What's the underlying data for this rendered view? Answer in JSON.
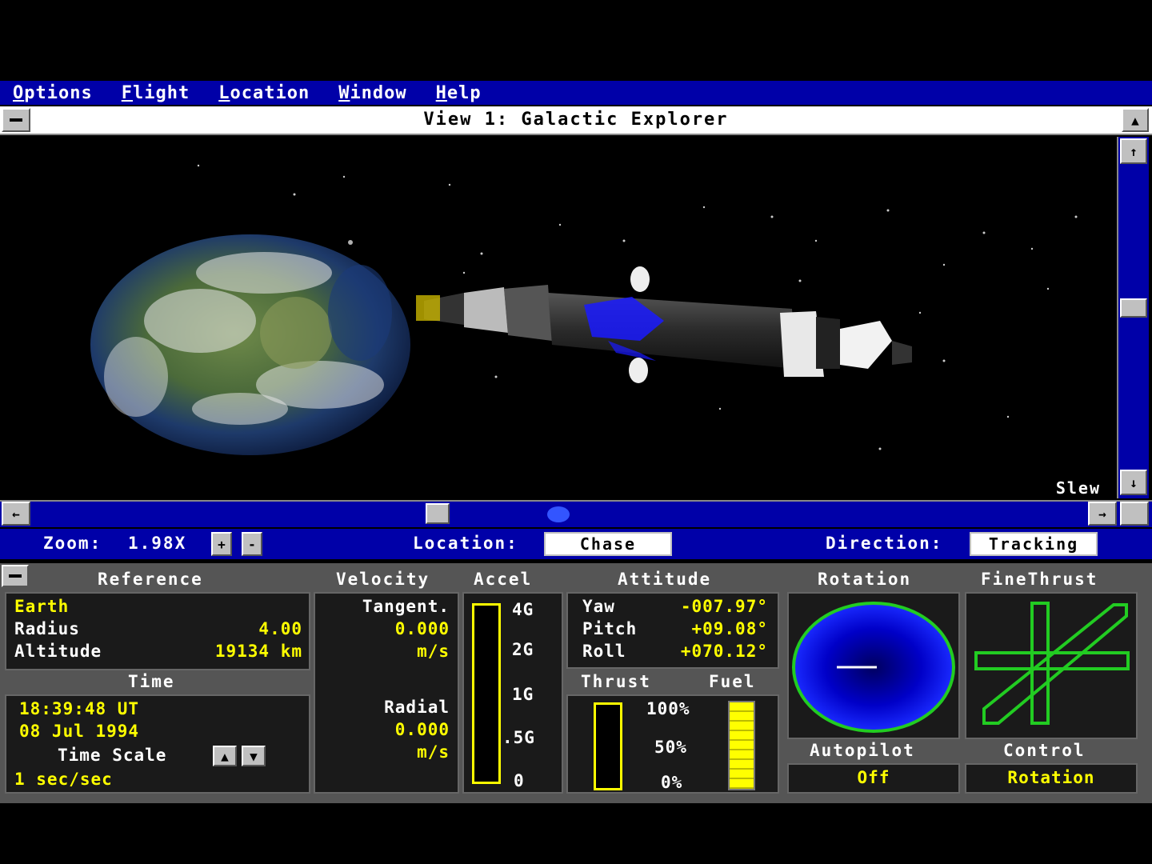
{
  "menu": {
    "items": [
      {
        "label": "Options"
      },
      {
        "label": "Flight"
      },
      {
        "label": "Location"
      },
      {
        "label": "Window"
      },
      {
        "label": "Help"
      }
    ]
  },
  "window": {
    "title": "View 1:  Galactic Explorer",
    "slew_label": "Slew"
  },
  "zoom": {
    "label": "Zoom:",
    "value": "1.98X",
    "location_label": "Location:",
    "location_value": "Chase",
    "direction_label": "Direction:",
    "direction_value": "Tracking"
  },
  "reference": {
    "header": "Reference",
    "body": "Earth",
    "radius_label": "Radius",
    "radius_value": "4.00",
    "altitude_label": "Altitude",
    "altitude_value": "19134 km"
  },
  "time": {
    "header": "Time",
    "clock": "18:39:48 UT",
    "date": "08 Jul 1994",
    "scale_label": "Time Scale",
    "scale_value": "1 sec/sec"
  },
  "velocity": {
    "header": "Velocity",
    "tangent_label": "Tangent.",
    "tangent_value": "0.000",
    "tangent_unit": "m/s",
    "radial_label": "Radial",
    "radial_value": "0.000",
    "radial_unit": "m/s"
  },
  "accel": {
    "header": "Accel",
    "ticks": [
      "4G",
      "2G",
      "1G",
      ".5G",
      "0"
    ],
    "level": 0
  },
  "attitude": {
    "header": "Attitude",
    "yaw_label": "Yaw",
    "yaw_value": "-007.97°",
    "pitch_label": "Pitch",
    "pitch_value": "+09.08°",
    "roll_label": "Roll",
    "roll_value": "+070.12°"
  },
  "thrust": {
    "thrust_label": "Thrust",
    "fuel_label": "Fuel",
    "ticks": [
      "100%",
      "50%",
      "0%"
    ],
    "thrust_level": 0,
    "fuel_level": 1.0
  },
  "rotation": {
    "header": "Rotation"
  },
  "finethrust": {
    "header": "FineThrust"
  },
  "autopilot": {
    "label": "Autopilot",
    "value": "Off"
  },
  "control": {
    "label": "Control",
    "value": "Rotation"
  },
  "colors": {
    "menu_blue": "#0000a8",
    "readout_yellow": "#ffff00",
    "panel_gray": "#555555"
  }
}
